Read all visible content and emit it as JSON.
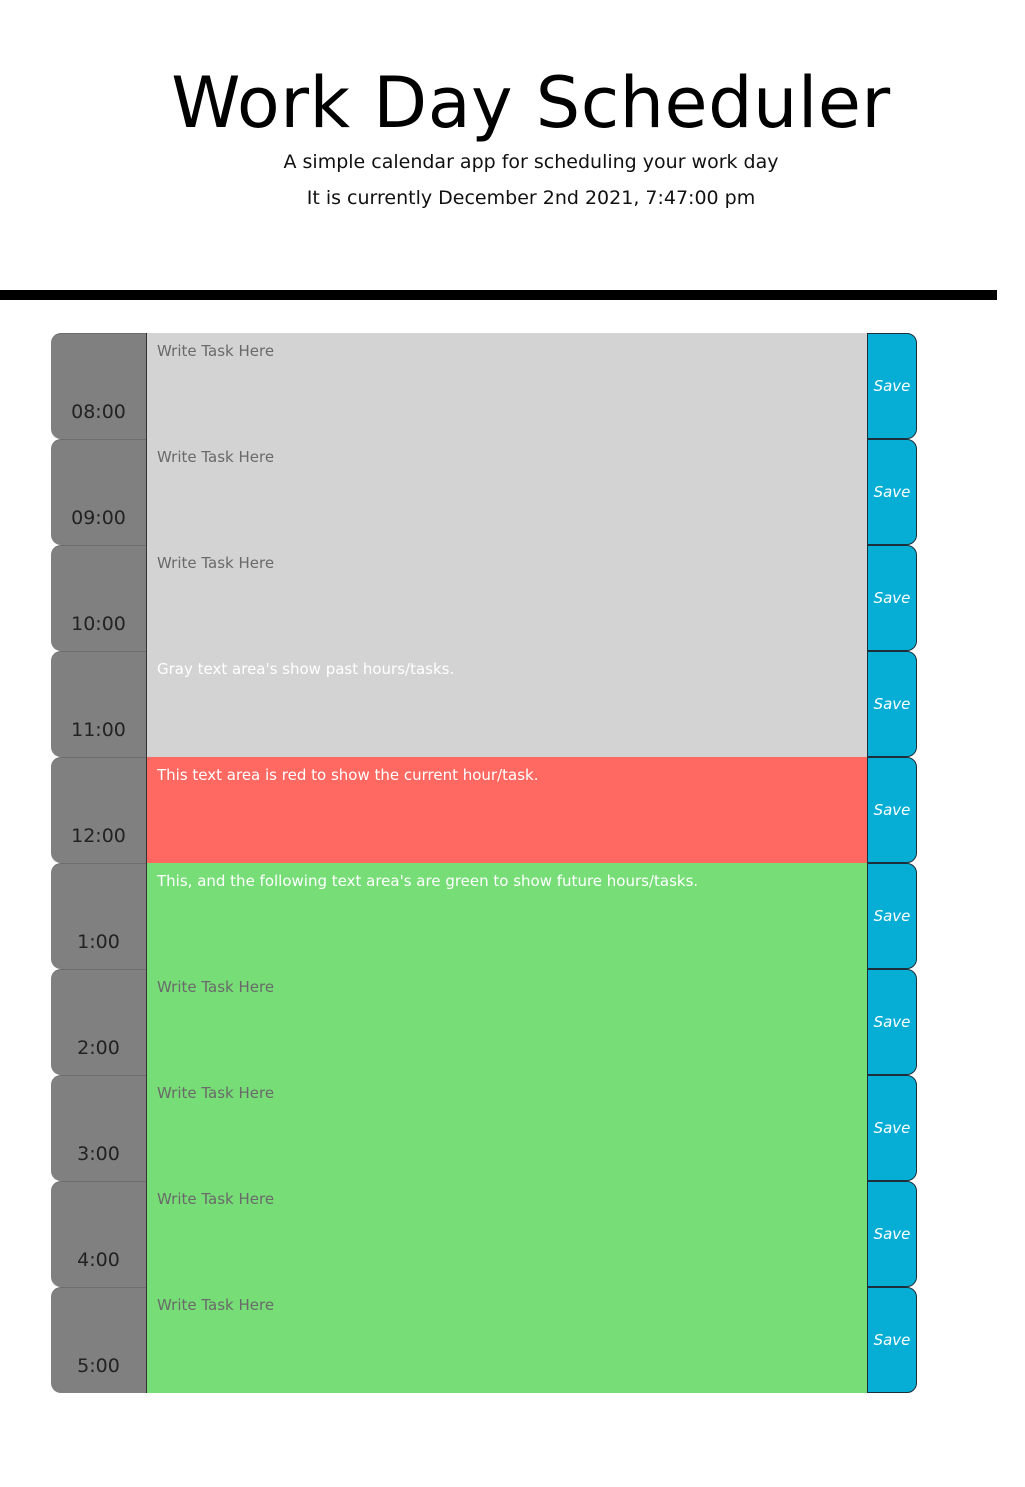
{
  "header": {
    "title": "Work Day Scheduler",
    "subtitle": "A simple calendar app for scheduling your work day",
    "current_datetime": "It is currently December 2nd 2021, 7:47:00 pm"
  },
  "colors": {
    "past": "#d3d3d3",
    "present": "#ff6961",
    "future": "#77dd77",
    "hour_block": "#808080",
    "save_button": "#06aed5"
  },
  "schedule": {
    "placeholder": "Write Task Here",
    "save_label": "Save",
    "rows": [
      {
        "hour": "08:00",
        "status": "past",
        "task": ""
      },
      {
        "hour": "09:00",
        "status": "past",
        "task": ""
      },
      {
        "hour": "10:00",
        "status": "past",
        "task": ""
      },
      {
        "hour": "11:00",
        "status": "past",
        "task": "Gray text area's show past hours/tasks."
      },
      {
        "hour": "12:00",
        "status": "present",
        "task": "This text area is red to show the current hour/task."
      },
      {
        "hour": "1:00",
        "status": "future",
        "task": "This, and the following text area's are green to show future hours/tasks."
      },
      {
        "hour": "2:00",
        "status": "future",
        "task": ""
      },
      {
        "hour": "3:00",
        "status": "future",
        "task": ""
      },
      {
        "hour": "4:00",
        "status": "future",
        "task": ""
      },
      {
        "hour": "5:00",
        "status": "future",
        "task": ""
      }
    ]
  }
}
